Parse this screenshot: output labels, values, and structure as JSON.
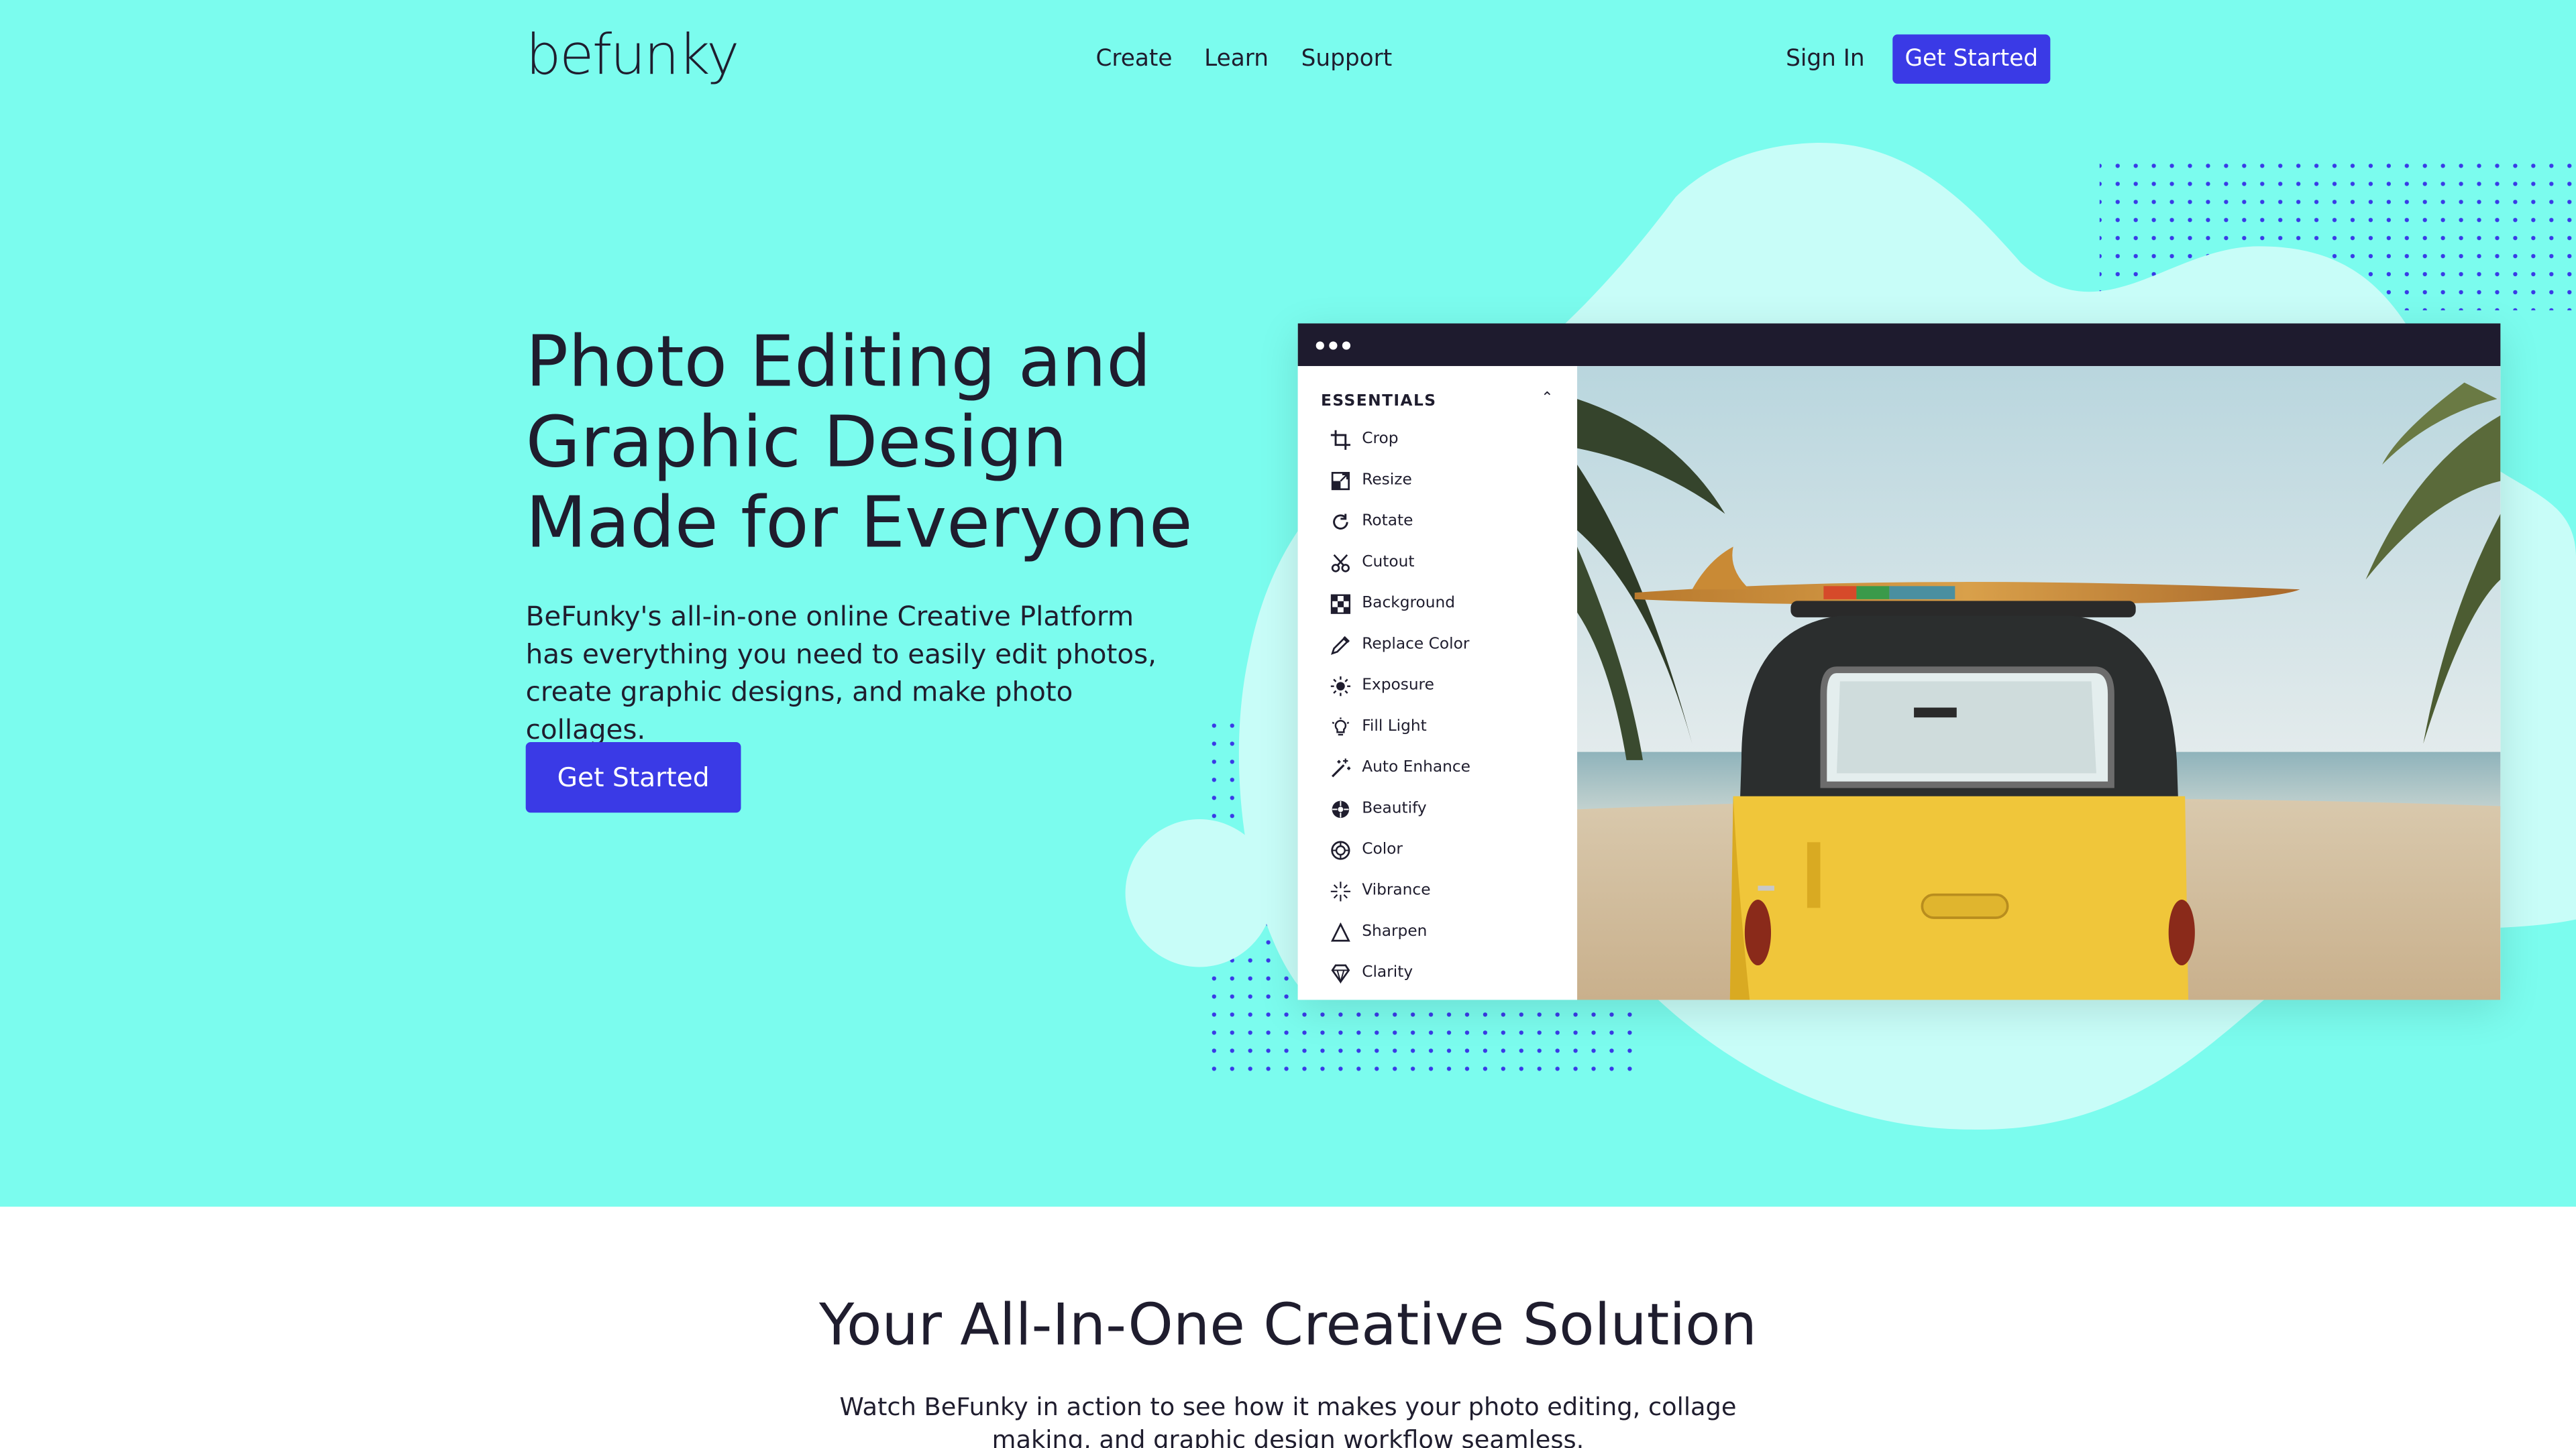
{
  "brand": {
    "logo_text": "befunky"
  },
  "nav": {
    "links": [
      "Create",
      "Learn",
      "Support"
    ],
    "sign_in": "Sign In",
    "cta": "Get Started"
  },
  "hero": {
    "headline": "Photo Editing and Graphic Design Made for Everyone",
    "subtext": "BeFunky's all-in-one online Creative Platform has everything you need to easily edit photos, create graphic designs, and make photo collages.",
    "cta": "Get Started"
  },
  "editor": {
    "panel_title": "ESSENTIALS",
    "tools": [
      {
        "label": "Crop",
        "icon": "crop-icon"
      },
      {
        "label": "Resize",
        "icon": "resize-icon"
      },
      {
        "label": "Rotate",
        "icon": "rotate-icon"
      },
      {
        "label": "Cutout",
        "icon": "scissors-icon"
      },
      {
        "label": "Background",
        "icon": "checkerboard-icon"
      },
      {
        "label": "Replace Color",
        "icon": "eyedropper-icon"
      },
      {
        "label": "Exposure",
        "icon": "sun-icon"
      },
      {
        "label": "Fill Light",
        "icon": "lightbulb-icon"
      },
      {
        "label": "Auto Enhance",
        "icon": "magic-wand-icon"
      },
      {
        "label": "Beautify",
        "icon": "flower-icon"
      },
      {
        "label": "Color",
        "icon": "color-wheel-icon"
      },
      {
        "label": "Vibrance",
        "icon": "sparkle-icon"
      },
      {
        "label": "Sharpen",
        "icon": "triangle-icon"
      },
      {
        "label": "Clarity",
        "icon": "diamond-icon"
      }
    ]
  },
  "section": {
    "title": "Your All-In-One Creative Solution",
    "subtitle": "Watch BeFunky in action to see how it makes your photo editing, collage making, and graphic design workflow seamless."
  },
  "colors": {
    "hero_bg": "#7bfcee",
    "blob": "#c8fdf8",
    "accent": "#3a3ae6",
    "text": "#1f1d2e",
    "editor_bar": "#1e1b2e"
  }
}
